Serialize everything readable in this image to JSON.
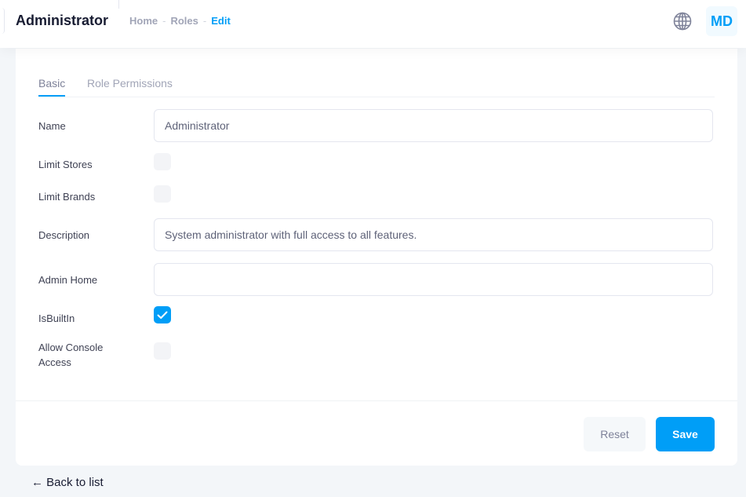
{
  "header": {
    "title": "Administrator",
    "breadcrumb": [
      "Home",
      "Roles",
      "Edit"
    ],
    "avatar_initials": "MD",
    "language_icon": "globe-icon"
  },
  "tabs": [
    {
      "label": "Basic",
      "active": true
    },
    {
      "label": "Role Permissions",
      "active": false
    }
  ],
  "form": {
    "name_label": "Name",
    "name_value": "Administrator",
    "limit_stores_label": "Limit Stores",
    "limit_stores_checked": false,
    "limit_brands_label": "Limit Brands",
    "limit_brands_checked": false,
    "description_label": "Description",
    "description_value": "System administrator with full access to all features.",
    "admin_home_label": "Admin Home",
    "admin_home_value": "",
    "is_built_in_label": "IsBuiltIn",
    "is_built_in_checked": true,
    "allow_console_label_line1": "Allow Console",
    "allow_console_label_line2": "Access",
    "allow_console_checked": false
  },
  "actions": {
    "reset_label": "Reset",
    "save_label": "Save"
  },
  "footer": {
    "back_link": "← Back to list"
  },
  "colors": {
    "accent": "#009ef7",
    "page_bg": "#f3f6f9",
    "muted_text": "#a1a5b7"
  }
}
